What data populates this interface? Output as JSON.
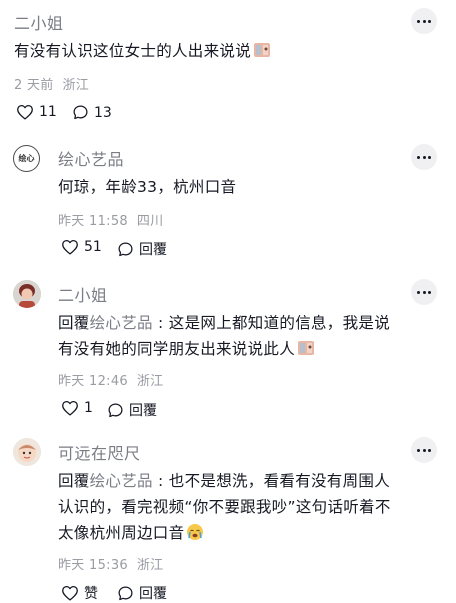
{
  "comments": [
    {
      "author": "二小姐",
      "text": "有没有认识这位女士的人出来说说",
      "time": "2 天前",
      "location": "浙江",
      "likes": "11",
      "replies": "13"
    },
    {
      "author": "绘心艺品",
      "text": "何琼，年龄33，杭州口音",
      "time": "昨天 11:58",
      "location": "四川",
      "likes": "51",
      "reply_label": "回覆",
      "avatar_text": "绘心"
    },
    {
      "author": "二小姐",
      "reply_prefix": "回覆",
      "reply_to": "绘心艺品",
      "reply_sep": " : ",
      "line1": "这是网上都知道的信息，我是说",
      "line2": "有没有她的同学朋友出来说说此人",
      "time": "昨天 12:46",
      "location": "浙江",
      "likes": "1",
      "reply_label": "回覆"
    },
    {
      "author": "可远在咫尺",
      "reply_prefix": "回覆",
      "reply_to": "绘心艺品",
      "reply_sep": " : ",
      "line1": "也不是想洗，看看有没有周围人",
      "line2": "认识的，看完视频“你不要跟我吵”这句话听着不",
      "line3": "太像杭州周边口音",
      "time": "昨天 15:36",
      "location": "浙江",
      "likes": "赞",
      "reply_label": "回覆"
    }
  ],
  "colors": {
    "text": "#161823",
    "muted": "#7b7d86",
    "meta": "#9a9ca3"
  }
}
